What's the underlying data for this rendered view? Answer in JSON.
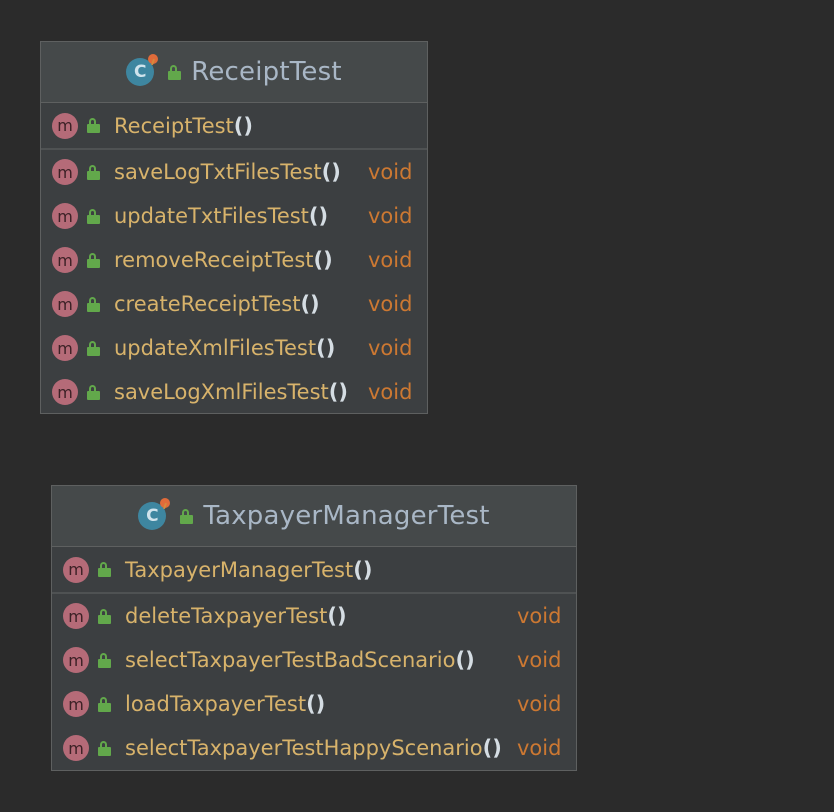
{
  "classes": [
    {
      "name": "ReceiptTest",
      "class_icon_letter": "C",
      "constructor": {
        "name": "ReceiptTest",
        "parens": "()"
      },
      "methods": [
        {
          "icon_letter": "m",
          "name": "saveLogTxtFilesTest",
          "parens": "()",
          "return_type": "void"
        },
        {
          "icon_letter": "m",
          "name": "updateTxtFilesTest",
          "parens": "()",
          "return_type": "void"
        },
        {
          "icon_letter": "m",
          "name": "removeReceiptTest",
          "parens": "()",
          "return_type": "void"
        },
        {
          "icon_letter": "m",
          "name": "createReceiptTest",
          "parens": "()",
          "return_type": "void"
        },
        {
          "icon_letter": "m",
          "name": "updateXmlFilesTest",
          "parens": "()",
          "return_type": "void"
        },
        {
          "icon_letter": "m",
          "name": "saveLogXmlFilesTest",
          "parens": "()",
          "return_type": "void"
        }
      ]
    },
    {
      "name": "TaxpayerManagerTest",
      "class_icon_letter": "C",
      "constructor": {
        "name": "TaxpayerManagerTest",
        "parens": "()"
      },
      "methods": [
        {
          "icon_letter": "m",
          "name": "deleteTaxpayerTest",
          "parens": "()",
          "return_type": "void"
        },
        {
          "icon_letter": "m",
          "name": "selectTaxpayerTestBadScenario",
          "parens": "()",
          "return_type": "void"
        },
        {
          "icon_letter": "m",
          "name": "loadTaxpayerTest",
          "parens": "()",
          "return_type": "void"
        },
        {
          "icon_letter": "m",
          "name": "selectTaxpayerTestHappyScenario",
          "parens": "()",
          "return_type": "void"
        }
      ]
    }
  ],
  "icons": {
    "class": "class-icon",
    "method": "method-icon",
    "visibility": "public-lock-icon"
  },
  "colors": {
    "background": "#2b2b2b",
    "box": "#3c3f41",
    "header": "#45494a",
    "method_name": "#d8b36b",
    "return_type": "#cc7832",
    "class_name": "#a9b7c6",
    "method_icon": "#b56b78",
    "class_icon": "#3e86a0",
    "lock": "#62a84b"
  }
}
